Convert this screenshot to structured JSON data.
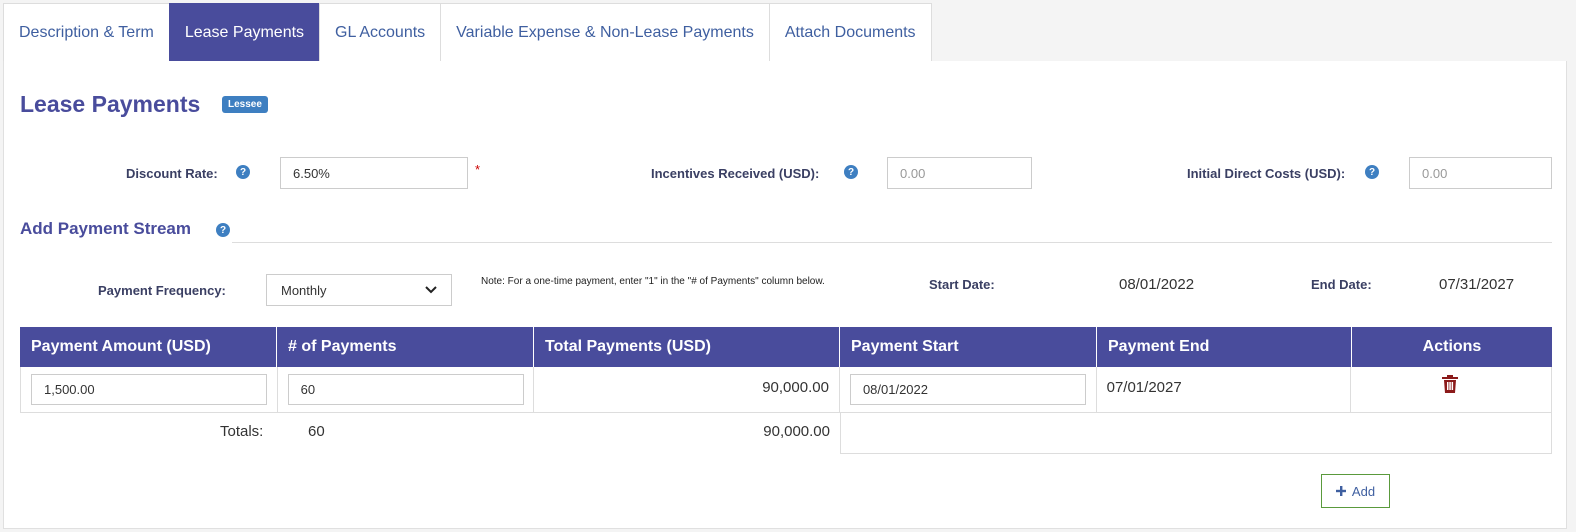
{
  "tabs": [
    {
      "label": "Description & Term",
      "active": false
    },
    {
      "label": "Lease Payments",
      "active": true
    },
    {
      "label": "GL Accounts",
      "active": false
    },
    {
      "label": "Variable Expense & Non-Lease Payments",
      "active": false
    },
    {
      "label": "Attach Documents",
      "active": false
    }
  ],
  "page": {
    "title": "Lease Payments",
    "badge": "Lessee"
  },
  "rates": {
    "discount_label": "Discount Rate:",
    "discount_value": "6.50%",
    "required_mark": "*",
    "incentives_label": "Incentives Received (USD):",
    "incentives_placeholder": "0.00",
    "idc_label": "Initial Direct Costs (USD):",
    "idc_placeholder": "0.00",
    "help_glyph": "?"
  },
  "stream": {
    "section_title": "Add Payment Stream",
    "frequency_label": "Payment Frequency:",
    "frequency_value": "Monthly",
    "note": "Note: For a one-time payment, enter \"1\" in the \"# of Payments\" column below.",
    "start_label": "Start Date:",
    "start_value": "08/01/2022",
    "end_label": "End Date:",
    "end_value": "07/31/2027"
  },
  "table": {
    "headers": [
      "Payment Amount (USD)",
      "# of Payments",
      "Total Payments (USD)",
      "Payment Start",
      "Payment End",
      "Actions"
    ],
    "row": {
      "amount": "1,500.00",
      "count": "60",
      "total": "90,000.00",
      "start": "08/01/2022",
      "end": "07/01/2027"
    },
    "totals_label": "Totals:",
    "totals_count": "60",
    "totals_amount": "90,000.00"
  },
  "add_button": {
    "icon": "plus-icon",
    "label": "Add"
  },
  "colors": {
    "accent": "#494c9c",
    "link": "#3f5fa0",
    "badge": "#3e7fc1",
    "delete": "#8b1a1a"
  }
}
